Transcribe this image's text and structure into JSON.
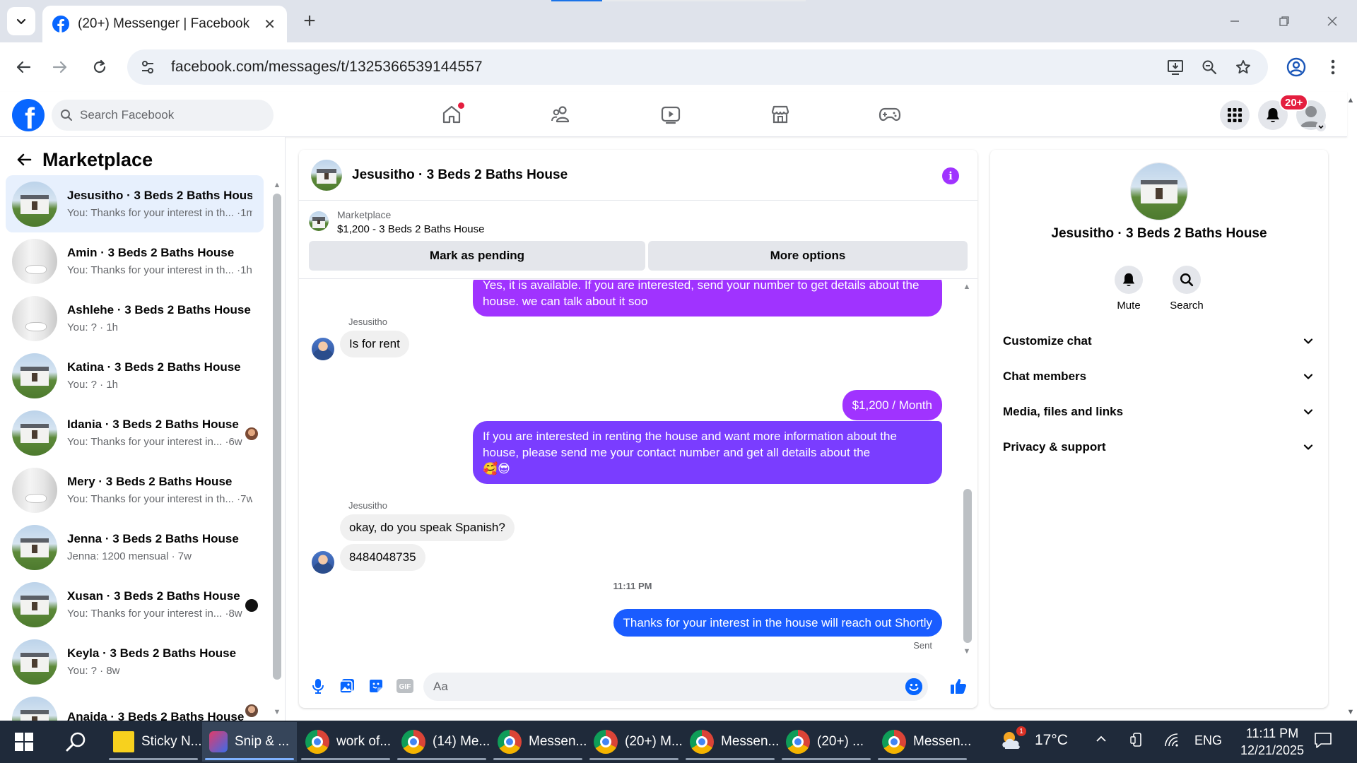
{
  "browser": {
    "tab_title": "(20+) Messenger | Facebook",
    "url": "facebook.com/messages/t/1325366539144557",
    "new_tab_symbol": "+",
    "close_symbol": "✕",
    "icons": [
      "tab-list-icon",
      "facebook-favicon",
      "back-icon",
      "forward-icon",
      "reload-icon",
      "site-info-icon",
      "install-app-icon",
      "zoom-icon",
      "bookmark-star-icon",
      "profile-icon",
      "kebab-menu-icon"
    ]
  },
  "fb_header": {
    "logo": "f",
    "search_placeholder": "Search Facebook",
    "notifications_badge": "20+",
    "nav_icons": [
      "home-icon",
      "friends-icon",
      "video-icon",
      "marketplace-icon",
      "gaming-icon"
    ]
  },
  "sidebar": {
    "title": "Marketplace",
    "conversations": [
      {
        "name": "Jesusitho · 3 Beds 2 Baths House",
        "snippet": "You: Thanks for your interest in th... ·1m",
        "thumb": "house",
        "active": true
      },
      {
        "name": "Amin · 3 Beds 2 Baths House",
        "snippet": "You: Thanks for your interest in th... ·1h",
        "thumb": "bath"
      },
      {
        "name": "Ashlehe · 3 Beds 2 Baths House",
        "snippet": "You: ? · 1h",
        "thumb": "bath"
      },
      {
        "name": "Katina · 3 Beds 2 Baths House",
        "snippet": "You: ? · 1h",
        "thumb": "house"
      },
      {
        "name": "Idania · 3 Beds 2 Baths House",
        "snippet": "You: Thanks for your interest in... ·6w",
        "thumb": "house"
      },
      {
        "name": "Mery · 3 Beds 2 Baths House",
        "snippet": "You: Thanks for your interest in th... ·7w",
        "thumb": "bath"
      },
      {
        "name": "Jenna · 3 Beds 2 Baths House",
        "snippet": "Jenna: 1200 mensual · 7w",
        "thumb": "house"
      },
      {
        "name": "Xusan · 3 Beds 2 Baths House",
        "snippet": "You: Thanks for your interest in... ·8w",
        "thumb": "house"
      },
      {
        "name": "Keyla · 3 Beds 2 Baths House",
        "snippet": "You: ? · 8w",
        "thumb": "house"
      },
      {
        "name": "Anaida · 3 Beds 2 Baths House",
        "snippet": "",
        "thumb": "house"
      }
    ]
  },
  "chat": {
    "title": "Jesusitho · 3 Beds 2 Baths House",
    "marketplace_label": "Marketplace",
    "listing": "$1,200 - 3 Beds 2 Baths House",
    "mark_pending_label": "Mark as pending",
    "more_options_label": "More options",
    "messages": {
      "out_1": "Yes, it is available. If you are interested, send your number to get details about the house. we can talk about it soo",
      "sender_1": "Jesusitho",
      "in_1": "Is for rent",
      "out_2": "$1,200 / Month",
      "out_3": "If you are interested in renting the house and want more information about the house, please send me your contact number and get all details about the",
      "out_3_emoji": "🥰😎",
      "sender_2": "Jesusitho",
      "in_2": "okay, do you speak Spanish?",
      "in_3": "8484048735",
      "timestamp": "11:11 PM",
      "out_4": "Thanks for your interest in the house will reach out Shortly",
      "status": "Sent"
    },
    "composer_placeholder": "Aa",
    "composer_icons": [
      "microphone-icon",
      "photo-icon",
      "sticker-icon",
      "gif-icon",
      "emoji-icon",
      "thumbs-up-icon"
    ],
    "gif_label": "GIF",
    "accent": "#a033ff"
  },
  "details": {
    "name": "Jesusitho · 3 Beds 2 Baths House",
    "mute_label": "Mute",
    "search_label": "Search",
    "sections": [
      "Customize chat",
      "Chat members",
      "Media, files and links",
      "Privacy & support"
    ]
  },
  "taskbar": {
    "apps": [
      {
        "label": "Sticky N...",
        "icon": "sticky-notes-icon"
      },
      {
        "label": "Snip & ...",
        "icon": "snipping-tool-icon",
        "active": true
      },
      {
        "label": "work of...",
        "icon": "chrome-icon"
      },
      {
        "label": "(14) Me...",
        "icon": "chrome-icon"
      },
      {
        "label": "Messen...",
        "icon": "chrome-icon"
      },
      {
        "label": "(20+) M...",
        "icon": "chrome-icon"
      },
      {
        "label": "Messen...",
        "icon": "chrome-icon"
      },
      {
        "label": "(20+) ...",
        "icon": "chrome-icon"
      },
      {
        "label": "Messen...",
        "icon": "chrome-icon"
      }
    ],
    "weather_badge": "1",
    "temperature": "17°C",
    "language": "ENG",
    "time": "11:11 PM",
    "date": "12/21/2025"
  }
}
